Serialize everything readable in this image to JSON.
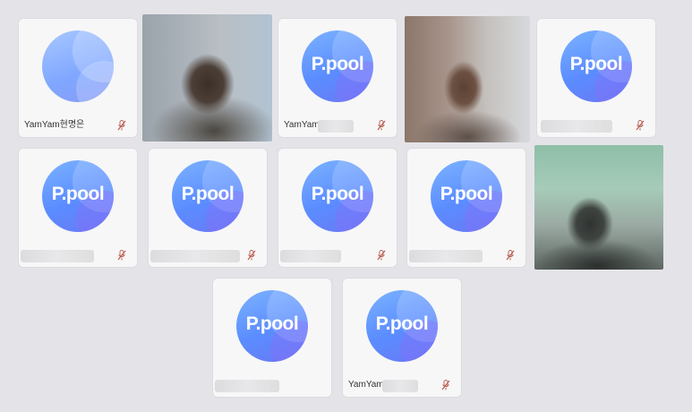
{
  "logo_text": "P.pool",
  "tiles": [
    {
      "name": "YamYam현명은"
    },
    {
      "name": ""
    },
    {
      "name": "YamYam"
    },
    {
      "name": ""
    },
    {
      "name": ""
    },
    {
      "name": ""
    },
    {
      "name": ""
    },
    {
      "name": ""
    },
    {
      "name": ""
    },
    {
      "name": ""
    },
    {
      "name": ""
    },
    {
      "name": "YamYam"
    }
  ],
  "mic_icon": "mic-muted-icon",
  "colors": {
    "background": "#e4e4e8",
    "tile": "#f7f7f8",
    "avatar_blue": "#5b8cff",
    "mic_muted": "#c0574a"
  }
}
